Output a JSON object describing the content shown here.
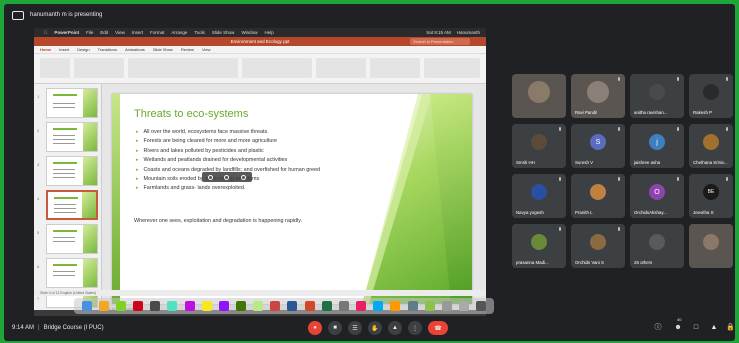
{
  "presenter": {
    "text": "hanumanth m is presenting"
  },
  "mac_menu": [
    "PowerPoint",
    "File",
    "Edit",
    "View",
    "Insert",
    "Format",
    "Arrange",
    "Tools",
    "Slide Show",
    "Window",
    "Help"
  ],
  "mac_status": {
    "clock": "Sat 9:15 AM",
    "user": "Hanumanth"
  },
  "ppt": {
    "filename": "Environment and Ecology ppt",
    "search_placeholder": "Search in Presentation",
    "tabs": [
      "Home",
      "Insert",
      "Design",
      "Transitions",
      "Animations",
      "Slide Show",
      "Review",
      "View"
    ],
    "slide_numbers": [
      "1",
      "2",
      "3",
      "4",
      "5",
      "6",
      "7"
    ],
    "notes_placeholder": "Click to add notes",
    "status": "Slide 4 of 12   English (United States)"
  },
  "slide": {
    "title": "Threats to eco-systems",
    "bullets": [
      "All over the world, ecosystems face massive threats.",
      "Forests are being cleared for more and more agriculture",
      "Rivers and lakes polluted by pesticides and plastic",
      "Wetlands and peatlands drained for developmental activities",
      "Coasts and oceans degraded by landfills; and overfished for human greed",
      "Mountain soils eroded by sand mining and dams",
      "Farmlands and grass- lands overexploited."
    ],
    "footer": "Wherever one sees, exploitation and degradation is happening rapidly."
  },
  "participants": [
    {
      "name": "",
      "initial": "",
      "color": "#6b5f55",
      "video": true
    },
    {
      "name": "Ravi Pandit",
      "initial": "",
      "color": "#7a7068",
      "video": true
    },
    {
      "name": "anitha ravishan...",
      "initial": "",
      "color": "#4a4a4a"
    },
    {
      "name": "Rakesh P",
      "initial": "",
      "color": "#2a2a2a"
    },
    {
      "name": "Smriti HH",
      "initial": "",
      "color": "#5c4b3b"
    },
    {
      "name": "Suresh V",
      "initial": "S",
      "color": "#5b6bc0"
    },
    {
      "name": "jaishree asha",
      "initial": "j",
      "color": "#3f7fbf"
    },
    {
      "name": "Chethana Sriniv...",
      "initial": "",
      "color": "#a07030"
    },
    {
      "name": "Navya yogesh",
      "initial": "",
      "color": "#2a4fa0"
    },
    {
      "name": "Pranith L",
      "initial": "",
      "color": "#c08040"
    },
    {
      "name": "OrchidsAkshay...",
      "initial": "O",
      "color": "#8e44ad"
    },
    {
      "name": "Jeevitha S",
      "initial": "BE",
      "color": "#1a1a1a"
    },
    {
      "name": "prasanna Madi...",
      "initial": "",
      "color": "#6a8a3a"
    },
    {
      "name": "Orchids Vani S",
      "initial": "",
      "color": "#8a6a40"
    },
    {
      "name": "26 others",
      "initial": "",
      "color": "#5a5a5a"
    },
    {
      "name": "",
      "initial": "",
      "color": "#6a5a48",
      "video": true
    }
  ],
  "meeting": {
    "time": "9:14 AM",
    "separator": "|",
    "title": "Bridge Course (I PUC)"
  },
  "badge": "40",
  "colors": {
    "frame": "#1fa63a",
    "meet_bg": "#202124",
    "end_call": "#ea4335",
    "slide_accent": "#6aa82e"
  }
}
